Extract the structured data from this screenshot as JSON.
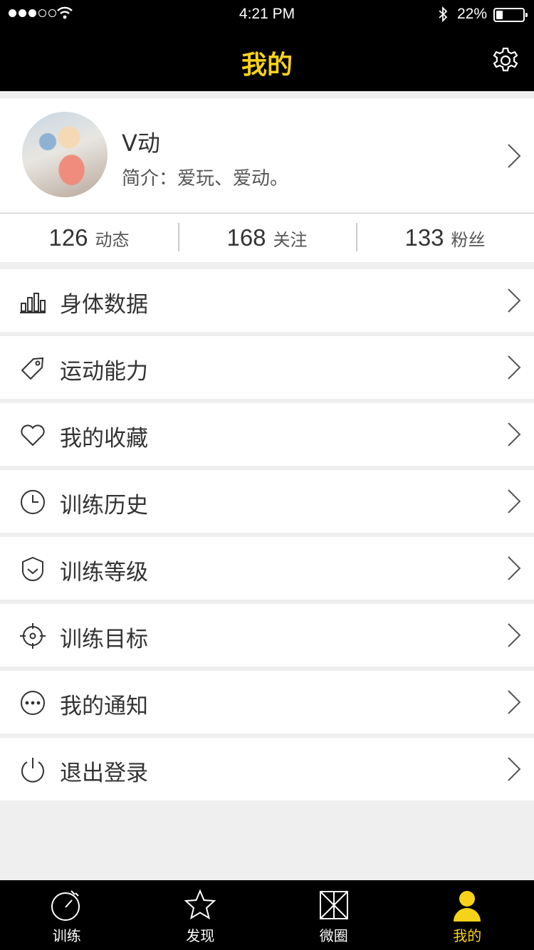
{
  "status_bar": {
    "time": "4:21 PM",
    "battery": "22%",
    "battery_level": 0.22,
    "signal_dots_filled": 3,
    "signal_dots_total": 5
  },
  "nav": {
    "title": "我的",
    "settings_icon": "gear-icon"
  },
  "profile": {
    "name": "V动",
    "bio": "简介：爱玩、爱动。"
  },
  "stats": [
    {
      "value": "126",
      "label": "动态"
    },
    {
      "value": "168",
      "label": "关注"
    },
    {
      "value": "133",
      "label": "粉丝"
    }
  ],
  "menu": [
    {
      "label": "身体数据",
      "icon": "bar-chart-icon"
    },
    {
      "label": "运动能力",
      "icon": "tag-icon"
    },
    {
      "label": "我的收藏",
      "icon": "heart-icon"
    },
    {
      "label": "训练历史",
      "icon": "clock-icon"
    },
    {
      "label": "训练等级",
      "icon": "shield-icon"
    },
    {
      "label": "训练目标",
      "icon": "target-icon"
    },
    {
      "label": "我的通知",
      "icon": "chat-dots-icon"
    },
    {
      "label": "退出登录",
      "icon": "power-icon"
    }
  ],
  "tabbar": {
    "tabs": [
      {
        "label": "训练",
        "icon": "stopwatch-icon"
      },
      {
        "label": "发现",
        "icon": "star-icon"
      },
      {
        "label": "微圈",
        "icon": "pinwheel-icon"
      },
      {
        "label": "我的",
        "icon": "person-icon",
        "active": true
      }
    ]
  },
  "colors": {
    "accent": "#f7d21a",
    "background": "#efefef",
    "bar": "#000000"
  }
}
